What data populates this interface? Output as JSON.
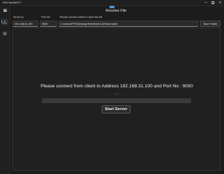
{
  "window": {
    "title": "FileTransferPC",
    "minimize_glyph": "—",
    "close_glyph": "✕"
  },
  "sidebar": {
    "items": [
      {
        "name": "menu",
        "icon": "hamburger-icon"
      },
      {
        "name": "receive",
        "icon": "download-icon",
        "selected": true
      },
      {
        "name": "send",
        "icon": "upload-icon"
      }
    ]
  },
  "page": {
    "badge": "NEW",
    "title": "Receive File"
  },
  "form": {
    "server_ip_label": "Server Ip",
    "server_ip_value": "192.168.31.100",
    "port_label": "Port No",
    "port_value": "9050",
    "folder_label": "Please choose where to save the file",
    "folder_value": "C:\\Users\\PTS\\Desktop\\Test\\Test16-02\\New folder",
    "save_folder_label": "Save Folder"
  },
  "status": {
    "message": "Please connect from client to Address 192.168.31.100 and Port No : 9050",
    "dashes": "-----",
    "progress": 0
  },
  "actions": {
    "start_server_label": "Start Server"
  },
  "colors": {
    "accent": "#5aa0e6",
    "background": "#1c1c1c"
  }
}
